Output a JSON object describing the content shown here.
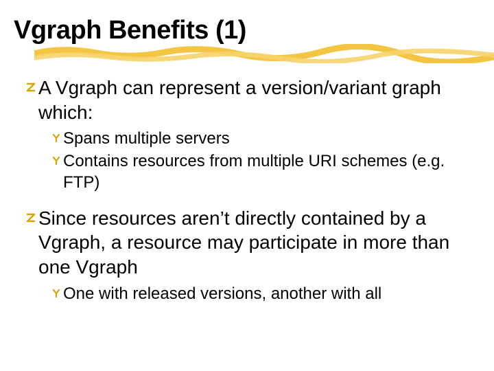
{
  "title": "Vgraph Benefits (1)",
  "bullets": {
    "b0": {
      "text": "A Vgraph can represent a version/variant graph which:",
      "sub": {
        "s0": "Spans multiple servers",
        "s1": "Contains resources from multiple URI schemes (e.g. FTP)"
      }
    },
    "b1": {
      "text": "Since resources aren’t directly contained by a Vgraph, a resource may participate in more than one Vgraph",
      "sub": {
        "s0": "One with released versions, another with all"
      }
    }
  }
}
